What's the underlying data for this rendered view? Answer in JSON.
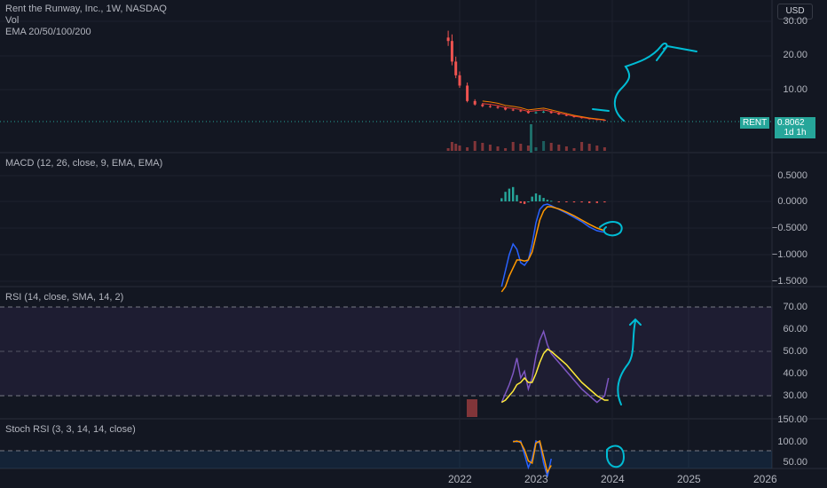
{
  "header": {
    "title": "Rent the Runway, Inc., 1W, NASDAQ",
    "vol": "Vol",
    "ema": "EMA 20/50/100/200"
  },
  "currency_button": "USD",
  "price_tag": {
    "symbol": "RENT",
    "price": "0.8062",
    "countdown": "1d 1h"
  },
  "panes": {
    "macd": {
      "label": "MACD (12, 26, close, 9, EMA, EMA)"
    },
    "rsi": {
      "label": "RSI (14, close, SMA, 14, 2)"
    },
    "stoch": {
      "label": "Stoch RSI (3, 3, 14, 14, close)"
    }
  },
  "colors": {
    "background": "#131722",
    "bull": "#26a69a",
    "bear": "#ef5350",
    "ema_orange": "#f57c00",
    "ema_red": "#e53935",
    "macd_line": "#2962ff",
    "signal_line": "#ff9800",
    "rsi_line": "#7e57c2",
    "rsi_ma": "#ffeb3b",
    "annotation": "#00bcd4"
  },
  "chart_data": [
    {
      "type": "line",
      "title": "Rent the Runway, Inc., 1W, NASDAQ",
      "y_ticks": [
        "30.00",
        "20.00",
        "10.00"
      ],
      "x_ticks": [
        "2022",
        "2023",
        "2024",
        "2025",
        "2026"
      ],
      "last_price": 0.8062,
      "x": [
        2021.85,
        2021.9,
        2021.95,
        2022.0,
        2022.1,
        2022.2,
        2022.3,
        2022.4,
        2022.5,
        2022.6,
        2022.7,
        2022.8,
        2022.9,
        2023.0,
        2023.1,
        2023.2,
        2023.3,
        2023.4,
        2023.5,
        2023.6,
        2023.7,
        2023.8,
        2023.9
      ],
      "series": [
        {
          "values": [
            24,
            18,
            14,
            11,
            6.5,
            5.5,
            5.0,
            4.8,
            4.5,
            4.0,
            3.8,
            3.5,
            3.0,
            3.2,
            3.4,
            3.0,
            2.6,
            2.2,
            1.8,
            1.5,
            1.2,
            1.0,
            0.8
          ]
        }
      ]
    },
    {
      "type": "line",
      "title": "MACD (12, 26, close, 9, EMA, EMA)",
      "y_ticks": [
        "0.5000",
        "0.0000",
        "−0.5000",
        "−1.0000",
        "−1.5000"
      ],
      "x": [
        2022.55,
        2022.6,
        2022.65,
        2022.7,
        2022.75,
        2022.8,
        2022.85,
        2022.9,
        2022.95,
        2023.0,
        2023.05,
        2023.1,
        2023.15,
        2023.2,
        2023.3,
        2023.4,
        2023.5,
        2023.6,
        2023.7,
        2023.8,
        2023.9
      ],
      "series": [
        {
          "values": [
            -1.6,
            -1.3,
            -1.0,
            -0.8,
            -0.9,
            -1.15,
            -1.2,
            -1.1,
            -0.8,
            -0.4,
            -0.15,
            -0.07,
            -0.05,
            -0.08,
            -0.15,
            -0.22,
            -0.3,
            -0.38,
            -0.48,
            -0.55,
            -0.58
          ]
        },
        {
          "values": [
            -1.7,
            -1.6,
            -1.4,
            -1.25,
            -1.1,
            -1.1,
            -1.12,
            -1.1,
            -0.95,
            -0.65,
            -0.35,
            -0.18,
            -0.1,
            -0.1,
            -0.14,
            -0.2,
            -0.27,
            -0.35,
            -0.43,
            -0.5,
            -0.55
          ]
        }
      ]
    },
    {
      "type": "line",
      "title": "RSI (14, close, SMA, 14, 2)",
      "y_ticks": [
        "70.00",
        "60.00",
        "50.00",
        "40.00",
        "30.00"
      ],
      "x": [
        2022.55,
        2022.6,
        2022.65,
        2022.7,
        2022.75,
        2022.8,
        2022.85,
        2022.9,
        2022.95,
        2023.0,
        2023.05,
        2023.1,
        2023.15,
        2023.2,
        2023.3,
        2023.4,
        2023.5,
        2023.6,
        2023.7,
        2023.8,
        2023.9,
        2023.95
      ],
      "series": [
        {
          "values": [
            27,
            31,
            35,
            40,
            47,
            38,
            41,
            33,
            38,
            48,
            55,
            59,
            53,
            49,
            45,
            41,
            37,
            33,
            30,
            27,
            30,
            38
          ]
        },
        {
          "values": [
            27,
            28,
            30,
            32,
            35,
            36,
            38,
            36,
            36,
            40,
            45,
            49,
            51,
            50,
            47,
            44,
            40,
            36,
            33,
            30,
            28,
            28
          ]
        }
      ]
    },
    {
      "type": "line",
      "title": "Stoch RSI (3, 3, 14, 14, close)",
      "y_ticks": [
        "150.00",
        "100.00",
        "50.00"
      ],
      "x": [
        2022.7,
        2022.75,
        2022.8,
        2022.85,
        2022.9,
        2022.95,
        2023.0,
        2023.05,
        2023.1,
        2023.15,
        2023.2
      ],
      "series": [
        {
          "values": [
            100,
            98,
            100,
            70,
            40,
            60,
            100,
            95,
            50,
            20,
            60
          ]
        },
        {
          "values": [
            98,
            100,
            97,
            80,
            55,
            50,
            95,
            100,
            65,
            30,
            45
          ]
        }
      ]
    }
  ]
}
